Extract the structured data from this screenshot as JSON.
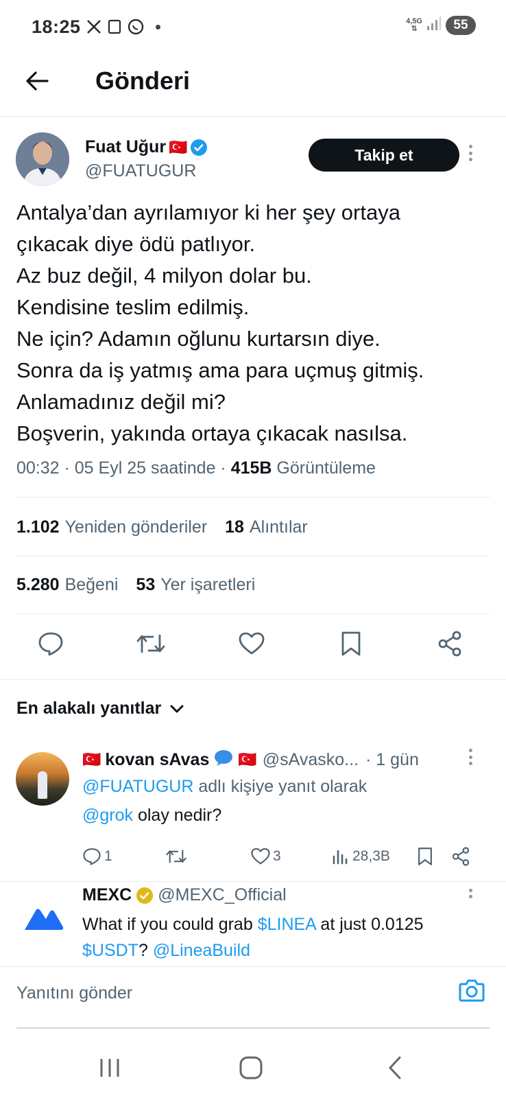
{
  "status_bar": {
    "time": "18:25",
    "network": "4,5G",
    "battery": "55",
    "icons": [
      "x-app-icon",
      "screen-icon",
      "whatsapp-icon",
      "notification-dot-icon"
    ]
  },
  "header": {
    "title": "Gönderi",
    "back_icon": "arrow-left-icon"
  },
  "post": {
    "author_name": "Fuat Uğur",
    "author_flag": "🇹🇷",
    "author_handle": "@FUATUGUR",
    "follow_label": "Takip et",
    "lines": [
      "Antalya’dan ayrılamıyor ki her şey ortaya",
      "çıkacak diye ödü patlıyor.",
      "Az buz değil, 4 milyon dolar bu.",
      "Kendisine teslim edilmiş.",
      "Ne için? Adamın oğlunu kurtarsın diye.",
      "Sonra da iş yatmış ama para uçmuş gitmiş.",
      "Anlamadınız değil mi?",
      "Boşverin, yakında ortaya çıkacak nasılsa."
    ],
    "meta_time": "00:32 · 05 Eyl 25 saatinde · ",
    "views_count": "415B",
    "views_label": " Görüntüleme"
  },
  "stats": {
    "reposts_count": "1.102",
    "reposts_label": "Yeniden gönderiler",
    "quotes_count": "18",
    "quotes_label": "Alıntılar",
    "likes_count": "5.280",
    "likes_label": "Beğeni",
    "bookmarks_count": "53",
    "bookmarks_label": "Yer işaretleri"
  },
  "actions": [
    "reply-icon",
    "repost-icon",
    "like-icon",
    "bookmark-icon",
    "share-icon"
  ],
  "replies_sort": {
    "label": "En alakalı yanıtlar",
    "icon": "chevron-down-icon"
  },
  "reply": {
    "flag_before": "🇹🇷",
    "name": "kovan sAvas",
    "badge": "🗨️",
    "flag_after": "🇹🇷",
    "handle": "@sAvasko...",
    "time": "· 1 gün",
    "context_mention": "@FUATUGUR",
    "context_label": " adlı kişiye yanıt olarak",
    "mention": "@grok",
    "text": " olay nedir?",
    "reply_count": "1",
    "like_count": "3",
    "view_count": "28,3B"
  },
  "ad": {
    "name": "MEXC",
    "handle": "@MEXC_Official",
    "line1_prefix": "What if you could grab ",
    "line1_ticker": "$LINEA",
    "line1_suffix": " at just 0.0125",
    "line2_ticker": "$USDT",
    "line2_mid": "? ",
    "line2_mention": "@LineaBuild"
  },
  "composer": {
    "placeholder": "Yanıtını gönder",
    "icon": "camera-icon"
  },
  "nav_bar": [
    "recent-apps-icon",
    "home-icon",
    "back-icon"
  ],
  "colors": {
    "accent_blue": "#1d9bf0",
    "text_primary": "#0f1419",
    "text_secondary": "#536471",
    "button_dark": "#0f1419",
    "mexc_blue": "#1f6cf5"
  }
}
